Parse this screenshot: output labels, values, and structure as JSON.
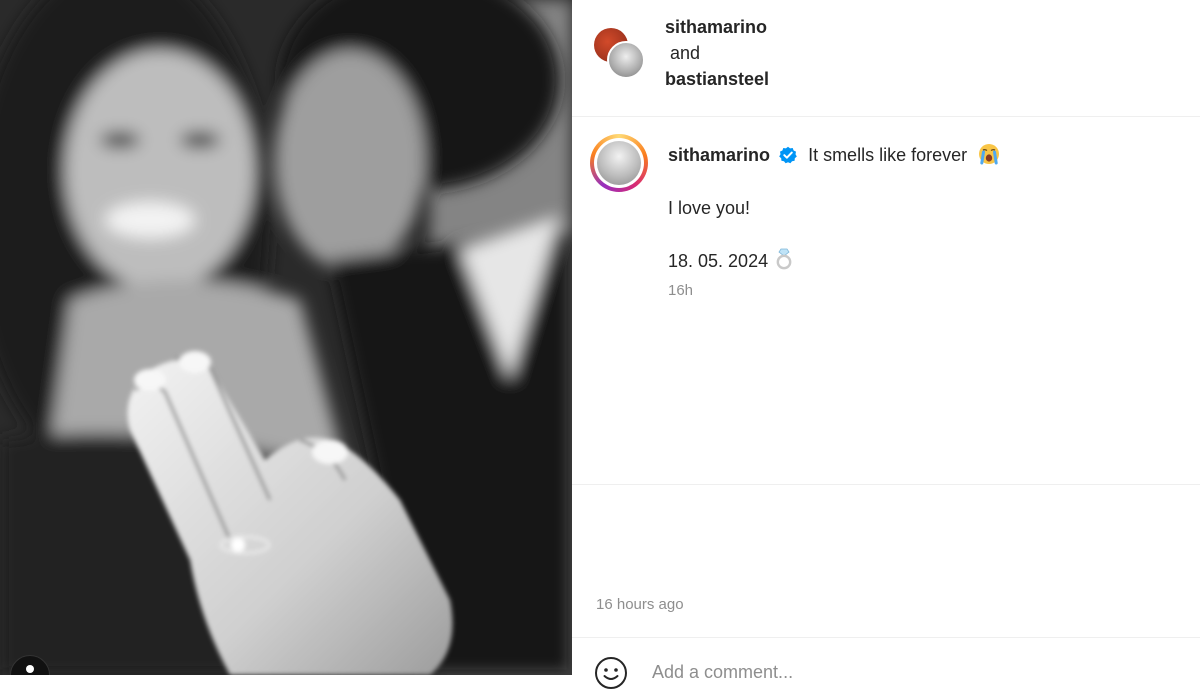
{
  "header": {
    "username_1": "sithamarino",
    "joiner": "and",
    "username_2": "bastiansteel"
  },
  "post": {
    "username": "sithamarino",
    "verified": true,
    "caption_line_1": "It smells like forever",
    "caption_emoji": "crying-face-emoji",
    "caption_line_2": "I love you!",
    "caption_line_3": "18. 05. 2024",
    "caption_line_3_emoji": "ring-emoji",
    "relative_time": "16h"
  },
  "footer": {
    "timestamp": "16 hours ago",
    "comment_placeholder": "Add a comment..."
  },
  "colors": {
    "verified": "#0095f6",
    "muted_text": "#8e8e8e",
    "story_ring": [
      "#feda75",
      "#fa7e1e",
      "#d62976",
      "#962fbf"
    ]
  }
}
